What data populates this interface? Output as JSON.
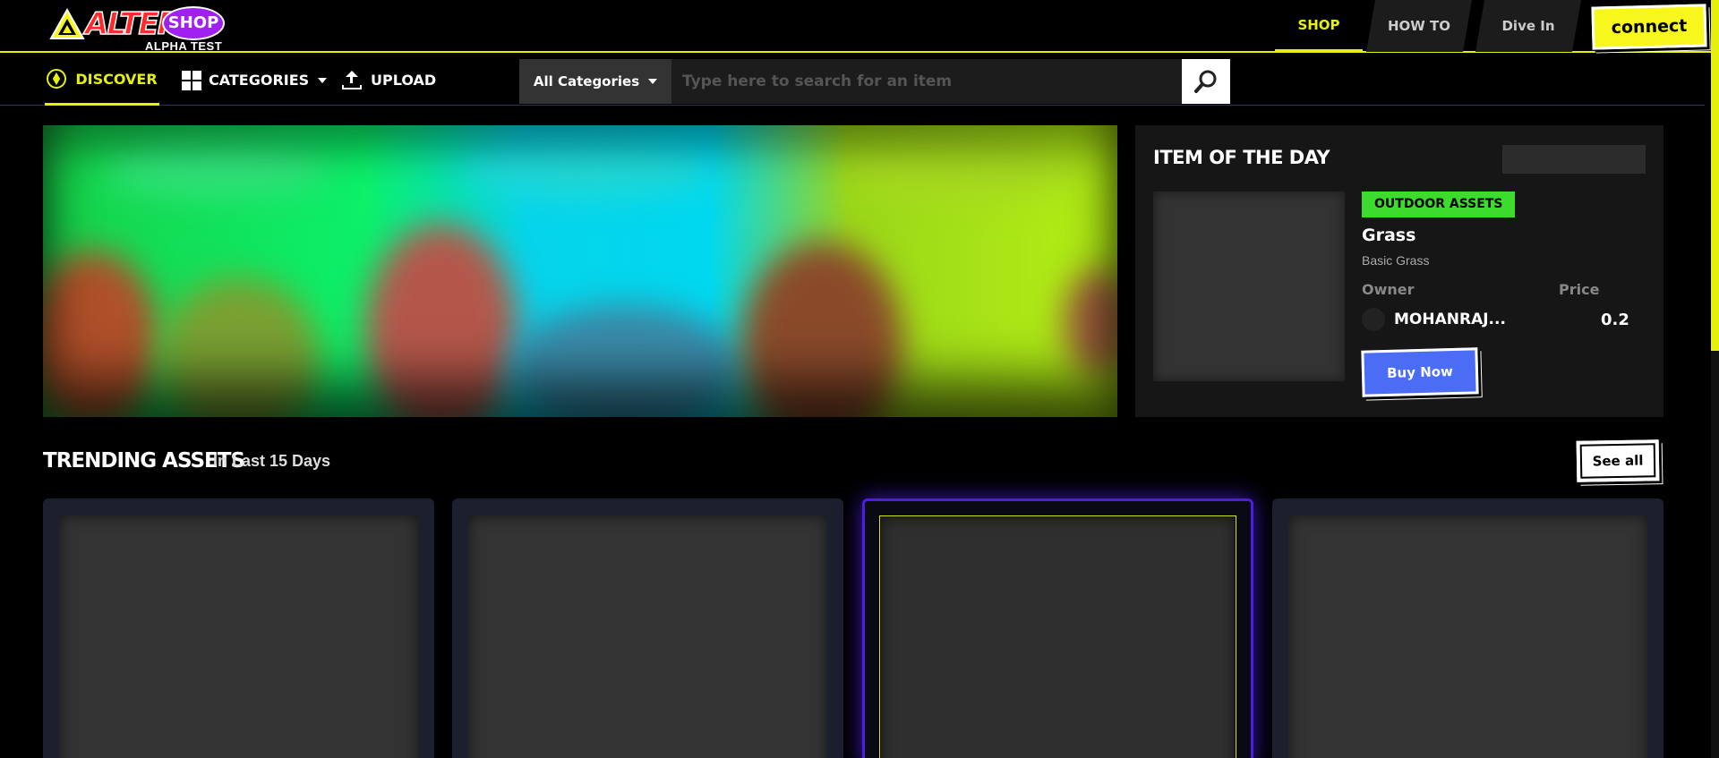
{
  "brand": {
    "name_alter": "ALTER",
    "name_shop": "SHOP",
    "subtitle": "ALPHA TEST",
    "accent": "#e6f00a"
  },
  "top_nav": {
    "tabs": [
      {
        "label": "SHOP",
        "active": true
      },
      {
        "label": "HOW TO",
        "active": false
      },
      {
        "label": "Dive In",
        "active": false
      }
    ],
    "connect_label": "connect"
  },
  "sub_nav": {
    "discover": "DISCOVER",
    "categories": "CATEGORIES",
    "upload": "UPLOAD"
  },
  "search": {
    "category_label": "All Categories",
    "placeholder": "Type here to search for an item"
  },
  "item_of_the_day": {
    "title": "ITEM OF THE DAY",
    "tag": "OUTDOOR ASSETS",
    "tag_color": "#3ddb2e",
    "name": "Grass",
    "description": "Basic Grass",
    "owner_label": "Owner",
    "price_label": "Price",
    "owner_name": "MOHANRAJ...",
    "price": "0.2",
    "buy_label": "Buy Now",
    "buy_color": "#4b6df6"
  },
  "trending": {
    "title": "TRENDING ASSETS",
    "subtitle": "In Last 15 Days",
    "see_all_label": "See all"
  }
}
